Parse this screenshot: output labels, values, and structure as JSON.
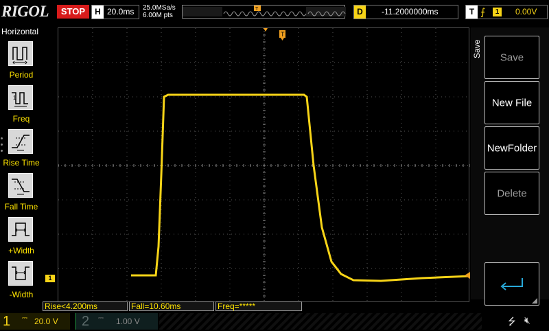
{
  "brand": {
    "logo": "RIGOL"
  },
  "run_state": {
    "label": "STOP"
  },
  "horizontal": {
    "label": "H",
    "timebase": "20.0ms",
    "sample_rate": "25.0MSa/s",
    "points": "6.00M pts"
  },
  "delay": {
    "label": "D",
    "value": "-11.2000000ms"
  },
  "trigger": {
    "label": "T",
    "source_channel": "1",
    "level": "0.00V"
  },
  "left_menu": {
    "title": "Horizontal",
    "items": [
      {
        "label": "Period",
        "icon": "period-icon"
      },
      {
        "label": "Freq",
        "icon": "freq-icon"
      },
      {
        "label": "Rise Time",
        "icon": "rise-time-icon"
      },
      {
        "label": "Fall Time",
        "icon": "fall-time-icon"
      },
      {
        "label": "+Width",
        "icon": "positive-width-icon"
      },
      {
        "label": "-Width",
        "icon": "negative-width-icon"
      }
    ]
  },
  "right_panel": {
    "title": "Save",
    "keys": [
      {
        "label": "Save",
        "enabled": false
      },
      {
        "label": "New File",
        "enabled": true
      },
      {
        "label": "NewFolder",
        "enabled": true
      },
      {
        "label": "Delete",
        "enabled": false
      },
      {
        "label": "",
        "icon": "enter-return-icon",
        "enabled": true
      }
    ]
  },
  "measurements": [
    {
      "text": "Rise<4.200ms"
    },
    {
      "text": "Fall=10.60ms"
    },
    {
      "text": "Freq=*****"
    }
  ],
  "channels": [
    {
      "number": "1",
      "scale": "20.0 V",
      "active": true,
      "color": "#f7d417"
    },
    {
      "number": "2",
      "scale": "1.00 V",
      "active": false,
      "color": "#5e6d6d"
    }
  ],
  "ch1_marker": {
    "label": "1"
  },
  "trace": {
    "color": "#f7d417"
  },
  "status_icons": [
    "usb-icon",
    "speaker-muted-icon"
  ]
}
